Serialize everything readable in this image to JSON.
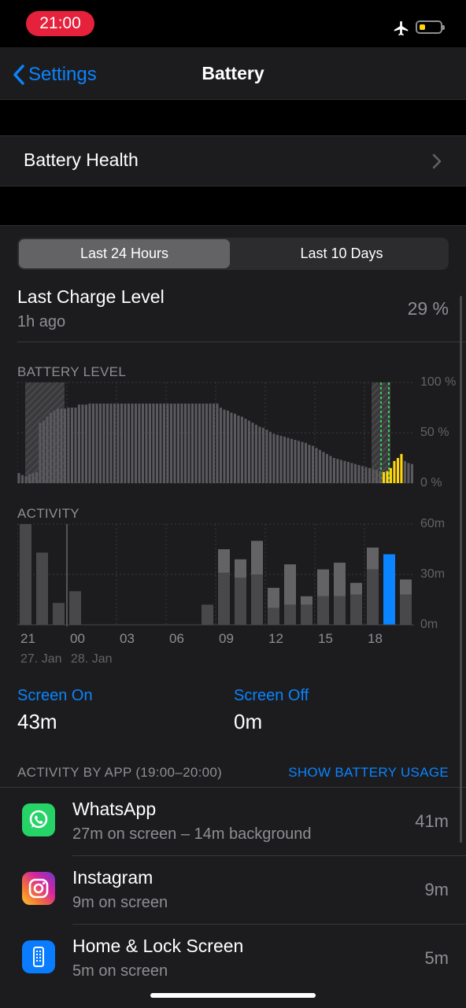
{
  "status_bar": {
    "time": "21:00"
  },
  "nav": {
    "back_label": "Settings",
    "title": "Battery"
  },
  "battery_health": {
    "label": "Battery Health"
  },
  "segment": {
    "options": [
      "Last 24 Hours",
      "Last 10 Days"
    ],
    "selected": "Last 24 Hours"
  },
  "last_charge": {
    "title": "Last Charge Level",
    "ago": "1h ago",
    "value": "29 %"
  },
  "battery_level": {
    "label": "BATTERY LEVEL",
    "axis": [
      "100 %",
      "50 %",
      "0 %"
    ]
  },
  "activity": {
    "label": "ACTIVITY",
    "axis": [
      "60m",
      "30m",
      "0m"
    ],
    "ticks": [
      "21",
      "00",
      "03",
      "06",
      "09",
      "12",
      "15",
      "18"
    ],
    "dates": [
      "27. Jan",
      "28. Jan"
    ]
  },
  "screen_on": {
    "label": "Screen On",
    "value": "43m"
  },
  "screen_off": {
    "label": "Screen Off",
    "value": "0m"
  },
  "activity_by_app": {
    "label": "ACTIVITY BY APP (19:00–20:00)",
    "link": "SHOW BATTERY USAGE",
    "apps": [
      {
        "name": "WhatsApp",
        "detail": "27m on screen – 14m background",
        "time": "41m",
        "icon": "whatsapp-icon",
        "color": "#25d366"
      },
      {
        "name": "Instagram",
        "detail": "9m on screen",
        "time": "9m",
        "icon": "instagram-icon",
        "color": "#d6249f"
      },
      {
        "name": "Home & Lock Screen",
        "detail": "5m on screen",
        "time": "5m",
        "icon": "phone-icon",
        "color": "#0a7cff"
      }
    ]
  },
  "chart_data": [
    {
      "type": "bar",
      "title": "BATTERY LEVEL",
      "ylim": [
        0,
        100
      ],
      "y_unit": "%",
      "values": [
        10,
        8,
        7,
        9,
        10,
        11,
        60,
        62,
        66,
        70,
        72,
        74,
        74,
        74,
        75,
        75,
        75,
        78,
        78,
        78,
        79,
        79,
        79,
        79,
        79,
        79,
        79,
        79,
        79,
        79,
        79,
        79,
        79,
        79,
        79,
        79,
        79,
        79,
        79,
        79,
        79,
        79,
        79,
        79,
        79,
        79,
        79,
        79,
        79,
        79,
        79,
        79,
        79,
        79,
        79,
        79,
        79,
        75,
        73,
        72,
        70,
        69,
        67,
        66,
        64,
        62,
        60,
        58,
        56,
        55,
        53,
        51,
        49,
        48,
        47,
        46,
        45,
        44,
        43,
        42,
        41,
        40,
        38,
        37,
        35,
        33,
        31,
        29,
        27,
        25,
        24,
        23,
        22,
        21,
        20,
        19,
        18,
        17,
        16,
        15,
        14,
        13,
        12,
        11,
        12,
        15,
        22,
        25,
        29,
        22,
        20,
        19
      ],
      "charging_color": "#ffd60a",
      "bar_color": "#5a5a5e"
    },
    {
      "type": "bar",
      "title": "ACTIVITY",
      "ylim": [
        0,
        60
      ],
      "y_unit": "min",
      "categories": [
        "21",
        "22",
        "23",
        "00",
        "01",
        "02",
        "03",
        "04",
        "05",
        "06",
        "07",
        "08",
        "09",
        "10",
        "11",
        "12",
        "13",
        "14",
        "15",
        "16",
        "17",
        "18",
        "19",
        "20"
      ],
      "series": [
        {
          "name": "Screen On",
          "values": [
            60,
            43,
            13,
            20,
            0,
            0,
            0,
            0,
            0,
            0,
            0,
            12,
            31,
            28,
            30,
            10,
            12,
            12,
            17,
            17,
            18,
            33,
            42,
            18
          ]
        },
        {
          "name": "Screen Off",
          "values": [
            0,
            0,
            0,
            0,
            0,
            0,
            0,
            0,
            0,
            0,
            0,
            0,
            14,
            11,
            20,
            12,
            24,
            5,
            16,
            20,
            7,
            13,
            0,
            9
          ]
        }
      ],
      "highlight_index": 22
    }
  ]
}
